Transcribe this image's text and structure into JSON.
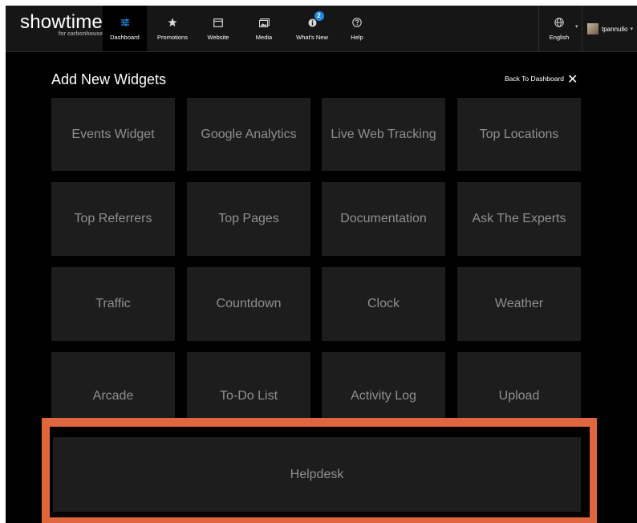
{
  "brand": {
    "name": "showtime",
    "sub": "for carbonhouse"
  },
  "nav": {
    "dashboard": "Dashboard",
    "promotions": "Promotions",
    "website": "Website",
    "media": "Media",
    "whats_new": "What's New",
    "whats_new_badge": "2",
    "help": "Help",
    "language": "English",
    "username": "tpannullo"
  },
  "page": {
    "title": "Add New Widgets",
    "back_label": "Back To Dashboard",
    "close": "✕"
  },
  "widgets": [
    "Events Widget",
    "Google Analytics",
    "Live Web Tracking",
    "Top Locations",
    "Top Referrers",
    "Top Pages",
    "Documentation",
    "Ask The Experts",
    "Traffic",
    "Countdown",
    "Clock",
    "Weather",
    "Arcade",
    "To-Do List",
    "Activity Log",
    "Upload",
    "Helpdesk"
  ],
  "colors": {
    "accent": "#1e88e5",
    "highlight": "#e0673d",
    "tile": "#1d1d1d"
  }
}
